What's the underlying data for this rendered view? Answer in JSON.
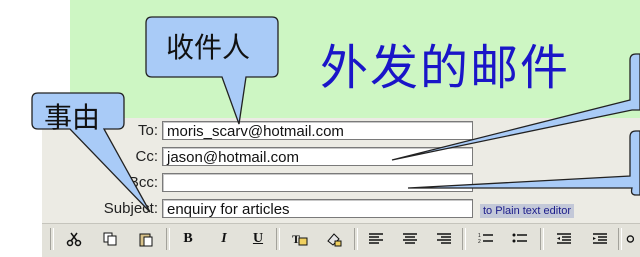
{
  "heading": "外发的邮件",
  "callouts": {
    "recipient": "收件人",
    "reason": "事由"
  },
  "form": {
    "to_label": "To:",
    "to_value": "moris_scarv@hotmail.com",
    "cc_label": "Cc:",
    "cc_value": "jason@hotmail.com",
    "bcc_label": "Bcc:",
    "bcc_value": "",
    "subject_label": "Subject:",
    "subject_value": "enquiry for articles"
  },
  "editor_link": "to Plain text editor",
  "colors": {
    "header_band": "#cdf6c3",
    "heading_text": "#1a15c8",
    "bubble_fill": "#a9cbf7",
    "form_bg": "#ecebe4"
  },
  "toolbar": [
    {
      "icon": "cut-icon"
    },
    {
      "icon": "copy-icon"
    },
    {
      "icon": "paste-icon"
    },
    {
      "icon": "bold-icon"
    },
    {
      "icon": "italic-icon"
    },
    {
      "icon": "underline-icon"
    },
    {
      "icon": "font-icon"
    },
    {
      "icon": "highlight-icon"
    },
    {
      "icon": "align-left-icon"
    },
    {
      "icon": "align-center-icon"
    },
    {
      "icon": "align-right-icon"
    },
    {
      "icon": "numbered-list-icon"
    },
    {
      "icon": "bullet-list-icon"
    },
    {
      "icon": "outdent-icon"
    },
    {
      "icon": "indent-icon"
    },
    {
      "icon": "link-icon"
    }
  ]
}
